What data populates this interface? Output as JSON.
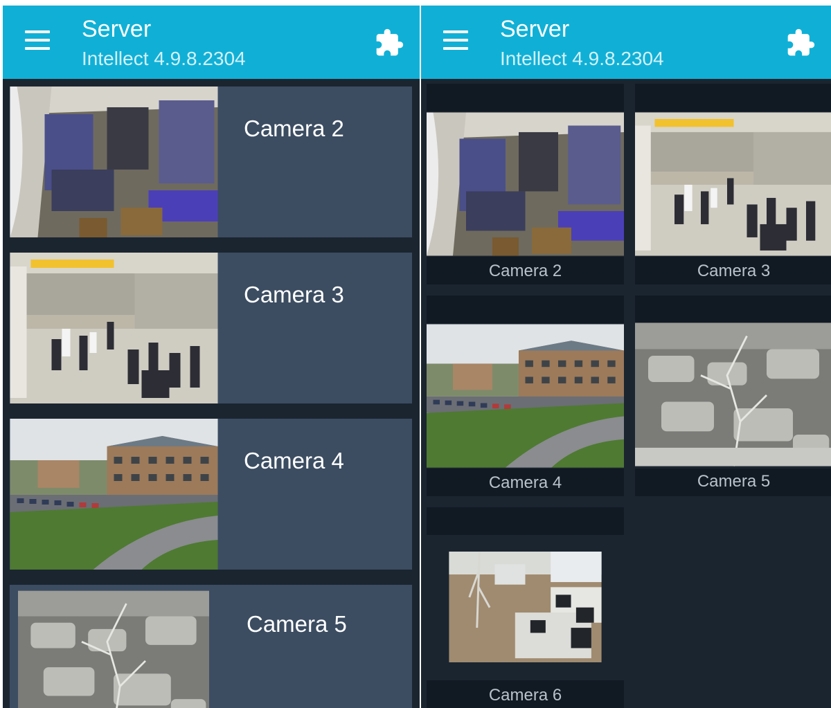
{
  "left_view": {
    "header": {
      "title": "Server",
      "subtitle": "Intellect 4.9.8.2304"
    },
    "cameras": [
      {
        "label": "Camera 2",
        "scene": "warehouse-interior"
      },
      {
        "label": "Camera 3",
        "scene": "airport-hall"
      },
      {
        "label": "Camera 4",
        "scene": "office-building-exterior"
      },
      {
        "label": "Camera 5",
        "scene": "parking-lot-grayscale"
      }
    ]
  },
  "right_view": {
    "header": {
      "title": "Server",
      "subtitle": "Intellect 4.9.8.2304"
    },
    "cameras": [
      {
        "label": "Camera 2",
        "scene": "warehouse-interior"
      },
      {
        "label": "Camera 3",
        "scene": "airport-hall"
      },
      {
        "label": "Camera 4",
        "scene": "office-building-exterior"
      },
      {
        "label": "Camera 5",
        "scene": "parking-lot-grayscale"
      },
      {
        "label": "Camera 6",
        "scene": "office-interior"
      }
    ]
  },
  "icons": {
    "menu": "hamburger-menu-icon",
    "plugins": "puzzle-piece-icon"
  },
  "colors": {
    "app_bar": "#10b0d6",
    "background": "#1b2530",
    "list_card": "#3c4d62",
    "tile_bar": "#111a23"
  }
}
